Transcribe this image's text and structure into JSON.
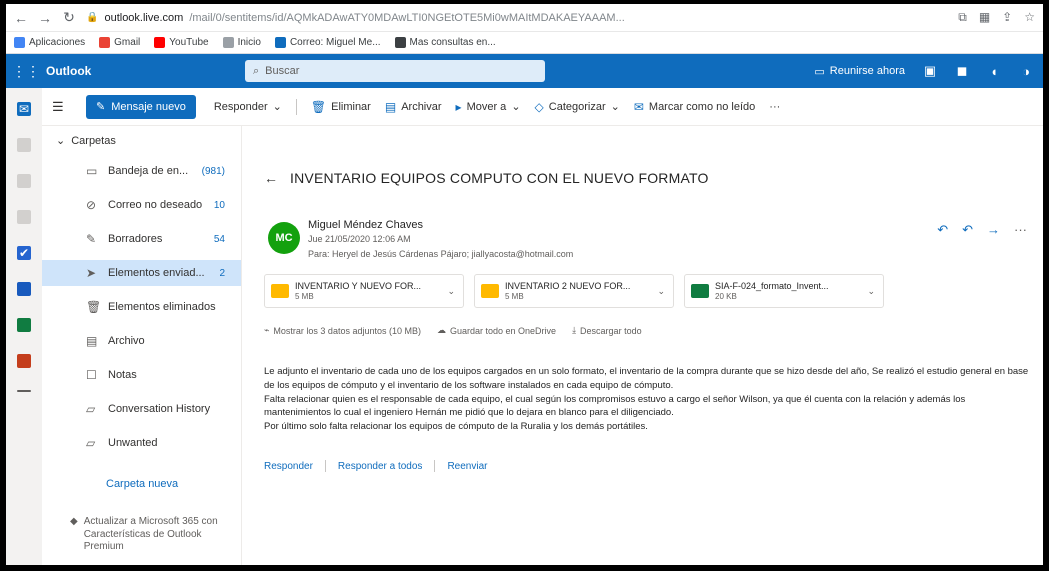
{
  "browser": {
    "url_domain": "outlook.live.com",
    "url_path": "/mail/0/sentitems/id/AQMkADAwATY0MDAwLTI0NGEtOTE5Mi0wMAItMDAKAEYAAAM..."
  },
  "bookmarks": [
    {
      "label": "Aplicaciones"
    },
    {
      "label": "Gmail"
    },
    {
      "label": "YouTube"
    },
    {
      "label": "Inicio"
    },
    {
      "label": "Correo: Miguel Me..."
    },
    {
      "label": "Mas consultas en..."
    }
  ],
  "header": {
    "brand": "Outlook",
    "search_placeholder": "Buscar",
    "meet_label": "Reunirse ahora"
  },
  "commands": {
    "new_message": "Mensaje nuevo",
    "reply": "Responder",
    "delete": "Eliminar",
    "archive": "Archivar",
    "move": "Mover a",
    "categorize": "Categorizar",
    "mark": "Marcar como no leído"
  },
  "folders": {
    "head": "Carpetas",
    "items": [
      {
        "label": "Bandeja de en...",
        "count": "(981)",
        "icon": "inbox-icon"
      },
      {
        "label": "Correo no deseado",
        "count": "10",
        "icon": "junk-icon"
      },
      {
        "label": "Borradores",
        "count": "54",
        "icon": "drafts-icon"
      },
      {
        "label": "Elementos enviad...",
        "count": "2",
        "icon": "sent-icon"
      },
      {
        "label": "Elementos eliminados",
        "count": "",
        "icon": "trash-icon"
      },
      {
        "label": "Archivo",
        "count": "",
        "icon": "archive-icon"
      },
      {
        "label": "Notas",
        "count": "",
        "icon": "notes-icon"
      },
      {
        "label": "Conversation History",
        "count": "",
        "icon": "folder-icon"
      },
      {
        "label": "Unwanted",
        "count": "",
        "icon": "folder-icon"
      }
    ],
    "new_folder": "Carpeta nueva",
    "upgrade": "Actualizar a Microsoft 365 con Características de Outlook Premium"
  },
  "message": {
    "subject": "INVENTARIO EQUIPOS COMPUTO CON EL NUEVO FORMATO",
    "avatar_initials": "MC",
    "sender": "Miguel Méndez Chaves",
    "date": "Jue 21/05/2020 12:06 AM",
    "to": "Para: Heryel de Jesús Cárdenas Pájaro; jiallyacosta@hotmail.com",
    "attachments": [
      {
        "name": "INVENTARIO Y NUEVO FOR...",
        "size": "5 MB",
        "type": "pdf"
      },
      {
        "name": "INVENTARIO 2 NUEVO FOR...",
        "size": "5 MB",
        "type": "pdf"
      },
      {
        "name": "SIA-F-024_formato_Invent...",
        "size": "20 KB",
        "type": "xls"
      }
    ],
    "attachment_links": {
      "show_all": "Mostrar los 3 datos adjuntos (10 MB)",
      "save_onedrive": "Guardar todo en OneDrive",
      "download": "Descargar todo"
    },
    "body": [
      "Le adjunto el inventario de cada uno de los equipos cargados en un solo formato, el inventario de la compra durante que se hizo desde del año, Se realizó el estudio general en base de los equipos de cómputo y el inventario de los software instalados en cada equipo de cómputo.",
      "Falta relacionar quien es el responsable de cada equipo, el cual según los compromisos estuvo a cargo el señor Wilson, ya que él cuenta con la relación y además los mantenimientos lo cual el ingeniero Hernán me pidió que lo dejara en blanco para el diligenciado.",
      "Por último solo falta relacionar los equipos de cómputo de la Ruralia y los demás portátiles."
    ],
    "reply_actions": {
      "reply": "Responder",
      "reply_all": "Responder a todos",
      "forward": "Reenviar"
    }
  },
  "colors": {
    "brand_blue": "#0f6cbd",
    "selected_folder": "#cfe4fa",
    "avatar_green": "#13a10e"
  }
}
